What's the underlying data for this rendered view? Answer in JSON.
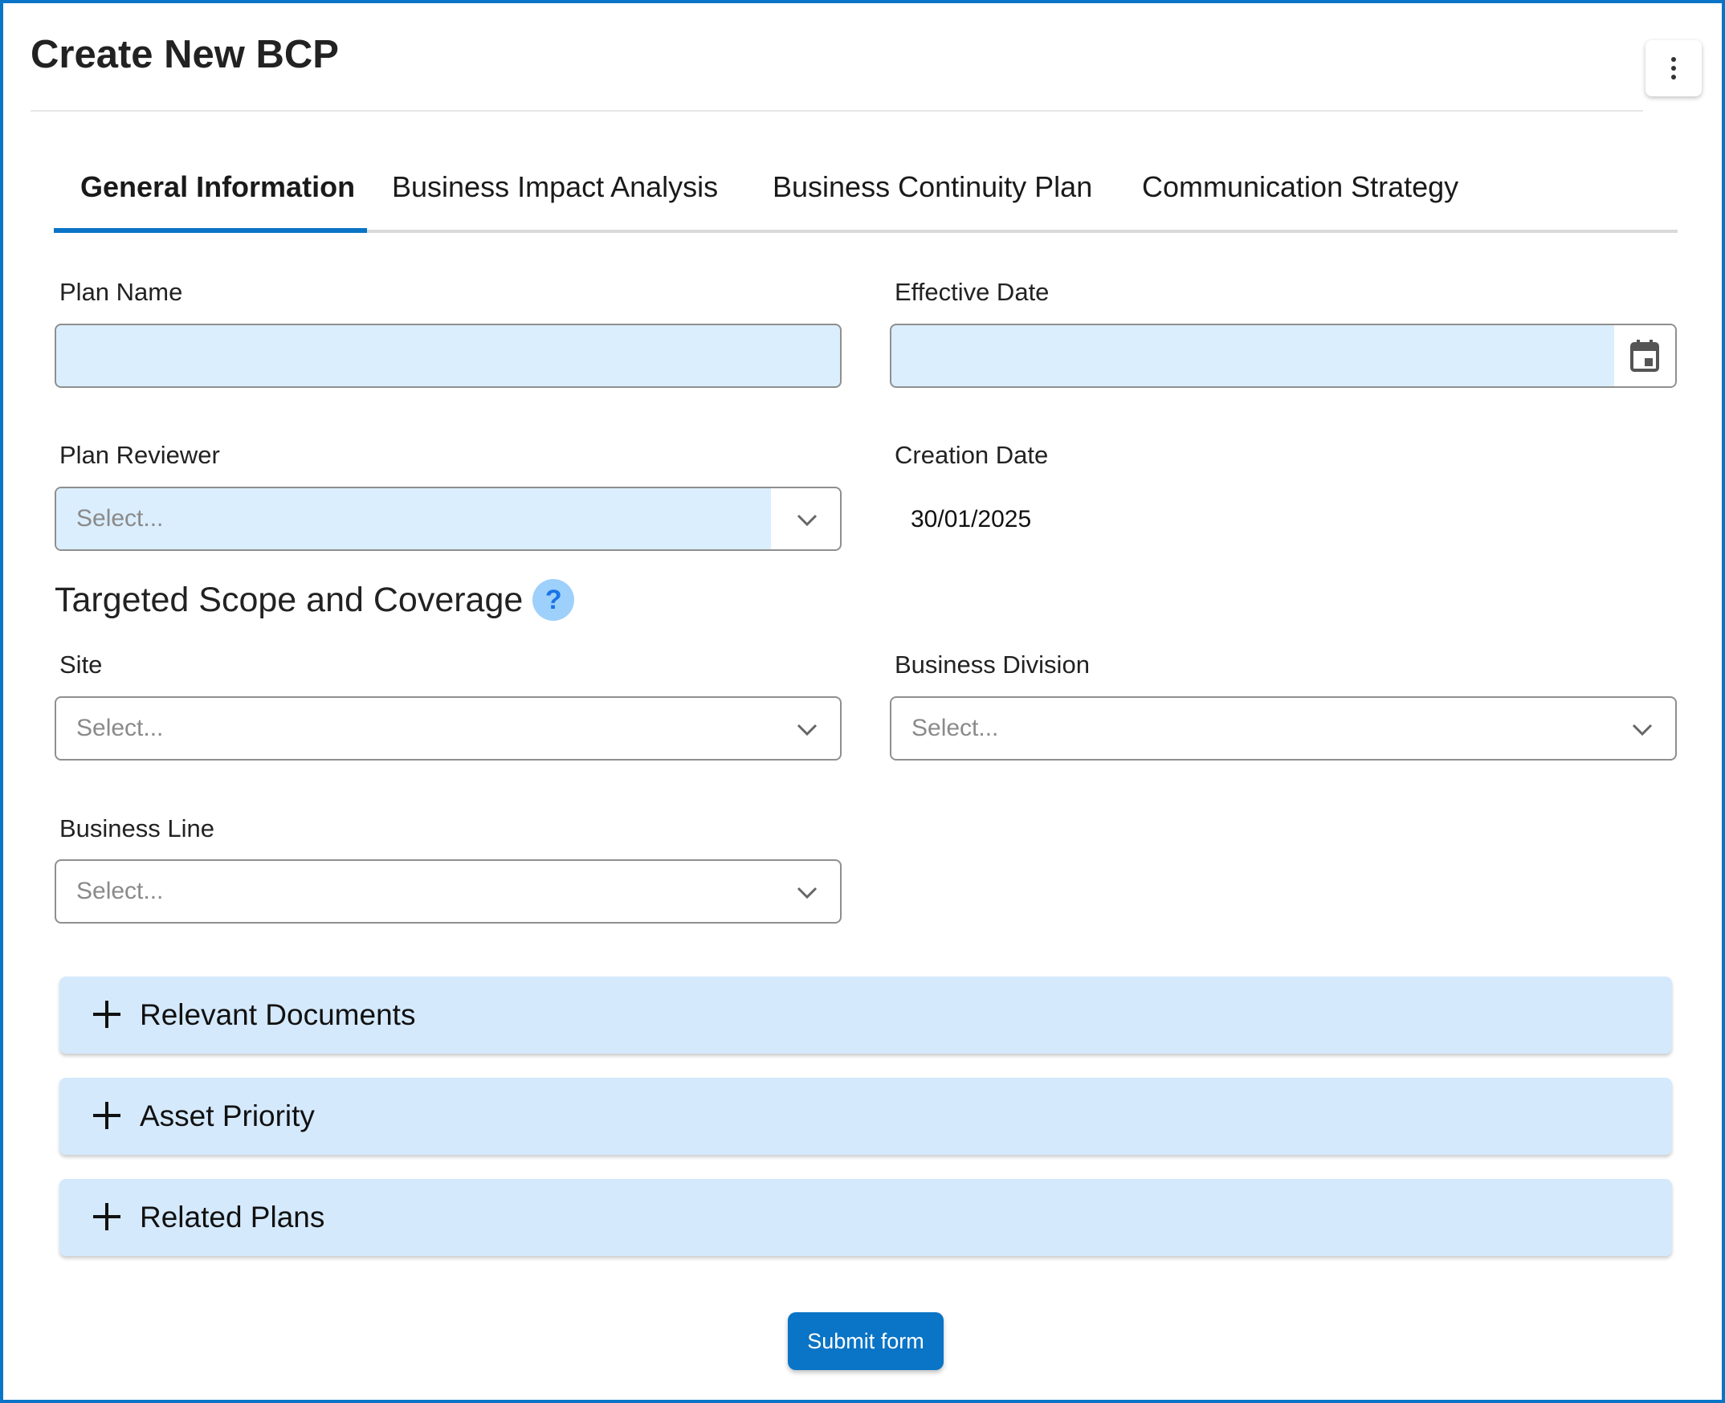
{
  "header": {
    "title": "Create New BCP",
    "menu_icon": "more-vertical-icon"
  },
  "tabs": [
    {
      "label": "General Information",
      "active": true
    },
    {
      "label": "Business Impact Analysis",
      "active": false
    },
    {
      "label": "Business Continuity Plan",
      "active": false
    },
    {
      "label": "Communication Strategy",
      "active": false
    }
  ],
  "form": {
    "plan_name": {
      "label": "Plan Name",
      "value": ""
    },
    "effective_date": {
      "label": "Effective Date",
      "value": "",
      "icon": "calendar-icon"
    },
    "plan_reviewer": {
      "label": "Plan Reviewer",
      "placeholder": "Select..."
    },
    "creation_date": {
      "label": "Creation Date",
      "value": "30/01/2025"
    },
    "scope_heading": "Targeted Scope and Coverage",
    "help_symbol": "?",
    "site": {
      "label": "Site",
      "placeholder": "Select..."
    },
    "business_division": {
      "label": "Business Division",
      "placeholder": "Select..."
    },
    "business_line": {
      "label": "Business Line",
      "placeholder": "Select..."
    }
  },
  "accordions": [
    {
      "label": "Relevant Documents"
    },
    {
      "label": "Asset Priority"
    },
    {
      "label": "Related Plans"
    }
  ],
  "actions": {
    "submit_label": "Submit form"
  },
  "colors": {
    "accent": "#0a74c6",
    "field_fill": "#dbeefd",
    "accordion_fill": "#d4e9fc"
  }
}
